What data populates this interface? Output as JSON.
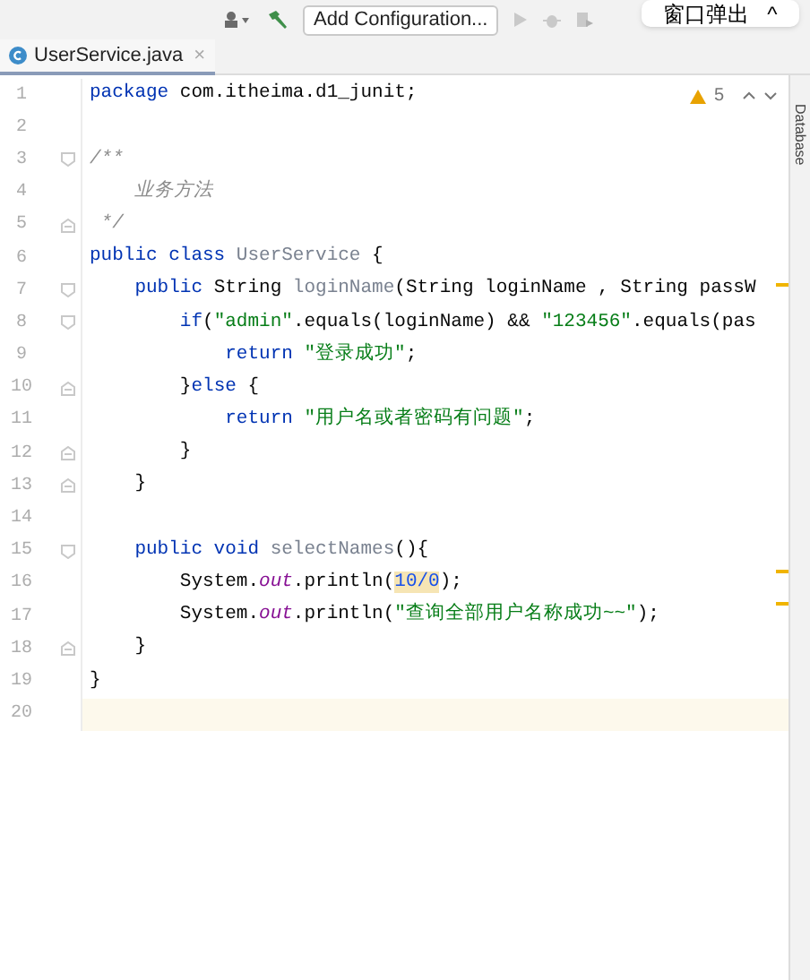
{
  "toolbar": {
    "config_button": "Add Configuration..."
  },
  "popup": {
    "title": "窗口弹出",
    "chevron": "^"
  },
  "tabs": [
    {
      "label": "UserService.java",
      "selected": true,
      "close": "×"
    }
  ],
  "inspections": {
    "count": "5"
  },
  "side_panel": {
    "label": "Database"
  },
  "editor": {
    "lines": [
      {
        "number": "1",
        "tokens": [
          {
            "kind": "keyword",
            "text": "package"
          },
          {
            "kind": "plain",
            "text": " com.itheima.d1_junit;"
          }
        ]
      },
      {
        "number": "2"
      },
      {
        "number": "3",
        "fold": {
          "kind": "start"
        },
        "tokens": [
          {
            "kind": "comment",
            "text": "/**"
          }
        ]
      },
      {
        "number": "4",
        "tokens": [
          {
            "kind": "comment",
            "text": "    业务方法"
          }
        ]
      },
      {
        "number": "5",
        "fold": {
          "kind": "end"
        },
        "tokens": [
          {
            "kind": "comment",
            "text": " */"
          }
        ]
      },
      {
        "number": "6",
        "tokens": [
          {
            "kind": "keyword",
            "text": "public class "
          },
          {
            "kind": "declaration",
            "text": "UserService"
          },
          {
            "kind": "plain",
            "text": " {"
          }
        ]
      },
      {
        "number": "7",
        "fold": {
          "kind": "start"
        },
        "tokens": [
          {
            "kind": "keyword",
            "text": "    public "
          },
          {
            "kind": "plain",
            "text": "String "
          },
          {
            "kind": "declaration",
            "text": "loginName"
          },
          {
            "kind": "plain",
            "text": "(String loginName , String passW"
          }
        ]
      },
      {
        "number": "8",
        "fold": {
          "kind": "start"
        },
        "tokens": [
          {
            "kind": "keyword",
            "text": "        if"
          },
          {
            "kind": "plain",
            "text": "("
          },
          {
            "kind": "string",
            "text": "\"admin\""
          },
          {
            "kind": "plain",
            "text": ".equals(loginName) && "
          },
          {
            "kind": "string",
            "text": "\"123456\""
          },
          {
            "kind": "plain",
            "text": ".equals(pas"
          }
        ]
      },
      {
        "number": "9",
        "tokens": [
          {
            "kind": "keyword",
            "text": "            return "
          },
          {
            "kind": "string",
            "text": "\"登录成功\""
          },
          {
            "kind": "plain",
            "text": ";"
          }
        ]
      },
      {
        "number": "10",
        "fold": {
          "kind": "end"
        },
        "tokens": [
          {
            "kind": "plain",
            "text": "        }"
          },
          {
            "kind": "keyword",
            "text": "else"
          },
          {
            "kind": "plain",
            "text": " {"
          }
        ]
      },
      {
        "number": "11",
        "tokens": [
          {
            "kind": "keyword",
            "text": "            return "
          },
          {
            "kind": "string",
            "text": "\"用户名或者密码有问题\""
          },
          {
            "kind": "plain",
            "text": ";"
          }
        ]
      },
      {
        "number": "12",
        "fold": {
          "kind": "end"
        },
        "tokens": [
          {
            "kind": "plain",
            "text": "        }"
          }
        ]
      },
      {
        "number": "13",
        "fold": {
          "kind": "end"
        },
        "tokens": [
          {
            "kind": "plain",
            "text": "    }"
          }
        ]
      },
      {
        "number": "14"
      },
      {
        "number": "15",
        "fold": {
          "kind": "start"
        },
        "tokens": [
          {
            "kind": "keyword",
            "text": "    public void "
          },
          {
            "kind": "declaration",
            "text": "selectNames"
          },
          {
            "kind": "plain",
            "text": "(){"
          }
        ]
      },
      {
        "number": "16",
        "tokens": [
          {
            "kind": "plain",
            "text": "        System."
          },
          {
            "kind": "field",
            "text": "out"
          },
          {
            "kind": "plain",
            "text": ".println("
          },
          {
            "kind": "warning_number",
            "text": "10/0"
          },
          {
            "kind": "plain",
            "text": ");"
          }
        ]
      },
      {
        "number": "17",
        "tokens": [
          {
            "kind": "plain",
            "text": "        System."
          },
          {
            "kind": "field",
            "text": "out"
          },
          {
            "kind": "plain",
            "text": ".println("
          },
          {
            "kind": "string",
            "text": "\"查询全部用户名称成功~~\""
          },
          {
            "kind": "plain",
            "text": ");"
          }
        ]
      },
      {
        "number": "18",
        "fold": {
          "kind": "end"
        },
        "tokens": [
          {
            "kind": "plain",
            "text": "    }"
          }
        ]
      },
      {
        "number": "19",
        "tokens": [
          {
            "kind": "plain",
            "text": "}"
          }
        ]
      },
      {
        "number": "20",
        "current": true
      }
    ]
  }
}
